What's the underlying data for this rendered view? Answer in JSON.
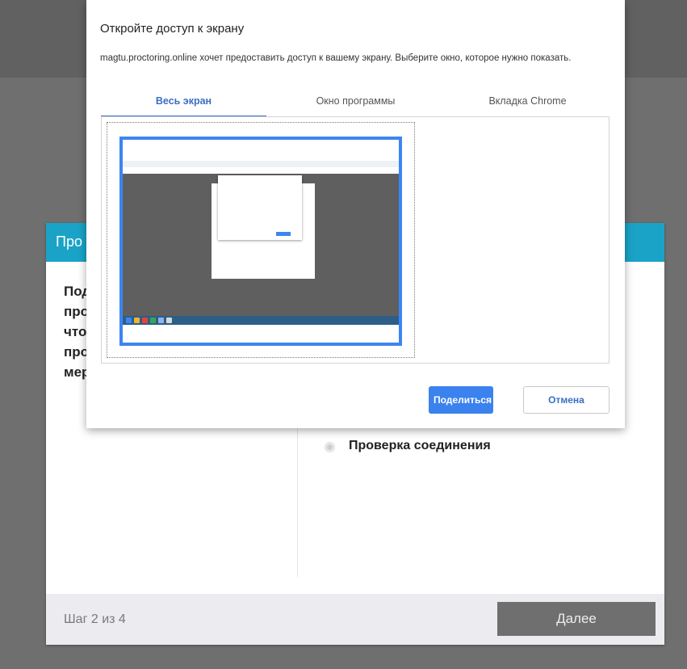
{
  "page": {
    "wizard_title": "Про",
    "wizard_text": [
      "Под",
      "про",
      "что",
      "про",
      "мер"
    ],
    "check_label": "Проверка соединения",
    "step_label": "Шаг 2 из 4",
    "next_label": "Далее"
  },
  "dialog": {
    "title": "Откройте доступ к экрану",
    "description": "magtu.proctoring.online хочет предоставить доступ к вашему экрану. Выберите окно, которое нужно показать.",
    "tabs": [
      {
        "label": "Весь экран",
        "active": true
      },
      {
        "label": "Окно программы",
        "active": false
      },
      {
        "label": "Вкладка Chrome",
        "active": false
      }
    ],
    "share_label": "Поделиться",
    "cancel_label": "Отмена"
  },
  "colors": {
    "accent": "#3b82ee",
    "header_teal": "#1aa3c7",
    "overlay": "#6f6f6f"
  }
}
